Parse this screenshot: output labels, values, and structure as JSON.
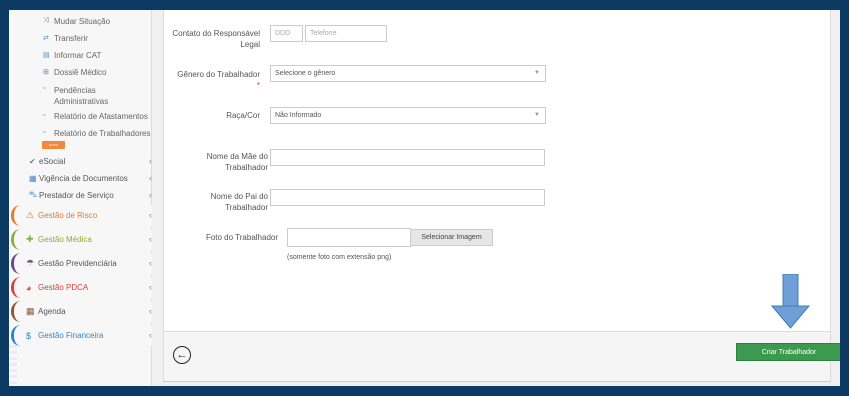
{
  "sidebar": {
    "sub_items": [
      {
        "label": "Mudar Situação",
        "icon": "shuffle-icon"
      },
      {
        "label": "Transferir",
        "icon": "transfer-icon"
      },
      {
        "label": "Informar CAT",
        "icon": "document-icon"
      },
      {
        "label": "Dossiê Médico",
        "icon": "plus-box-icon"
      },
      {
        "label": "Pendências Administrativas",
        "icon": "document-icon"
      },
      {
        "label": "Relatório de Afastamentos",
        "icon": "document-icon"
      },
      {
        "label": "Relatório de Trabalhadores",
        "icon": "document-icon"
      }
    ],
    "new_tag": "novo",
    "nav_items": [
      {
        "label": "eSocial",
        "icon": "check-icon"
      },
      {
        "label": "Vigência de Documentos",
        "icon": "calendar-icon"
      },
      {
        "label": "Prestador de Serviço",
        "icon": "car-icon"
      }
    ],
    "groups": [
      {
        "label": "Gestão de Risco",
        "icon": "warning-icon",
        "color": "#e57a2f"
      },
      {
        "label": "Gestão Médica",
        "icon": "medical-icon",
        "color": "#8cae3a"
      },
      {
        "label": "Gestão Previdenciária",
        "icon": "umbrella-icon",
        "color": "#6b4a8a"
      },
      {
        "label": "Gestão PDCA",
        "icon": "pie-chart-icon",
        "color": "#d9413b"
      },
      {
        "label": "Agenda",
        "icon": "calendar-icon",
        "color": "#8b5a3c"
      },
      {
        "label": "Gestão Financeira",
        "icon": "dollar-icon",
        "color": "#2f86c6"
      }
    ]
  },
  "form": {
    "contact_label": "Contato do Responsável Legal",
    "ddd_placeholder": "DDD",
    "phone_placeholder": "Telefone",
    "gender_label": "Gênero do Trabalhador",
    "gender_required": "*",
    "gender_value": "Selecione o gênero",
    "race_label": "Raça/Cor",
    "race_value": "Não Informado",
    "mother_label": "Nome da Mãe do Trabalhador",
    "mother_value": "",
    "father_label": "Nome do Pai do Trabalhador",
    "father_value": "",
    "photo_label": "Foto do Trabalhador",
    "photo_button": "Selecionar Imagem",
    "photo_hint": "(somente foto com extensão png)"
  },
  "footer": {
    "back_icon": "back-arrow-icon",
    "submit_label": "Criar Trabalhador"
  },
  "annotation": {
    "arrow_color": "#6e9fd6"
  }
}
